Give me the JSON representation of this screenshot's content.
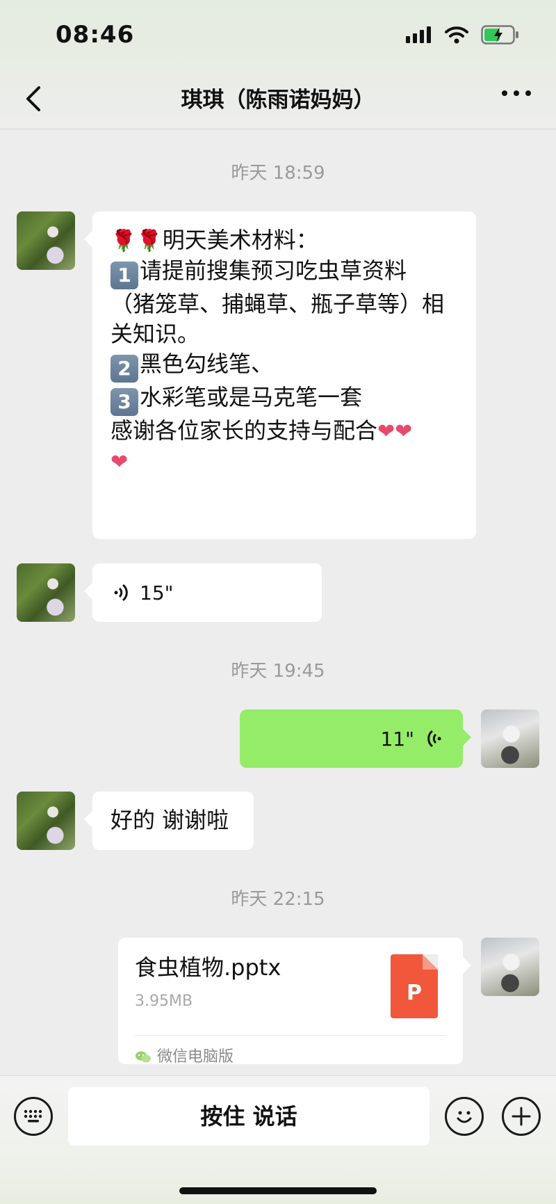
{
  "status": {
    "time": "08:46"
  },
  "nav": {
    "title": "琪琪（陈雨诺妈妈）"
  },
  "timestamps": [
    "昨天 18:59",
    "昨天 19:45",
    "昨天 22:15"
  ],
  "messages": {
    "m1": {
      "lines": [
        "明天美术材料：",
        "",
        "请提前搜集预习吃虫草资料",
        "（猪笼草、捕蝇草、瓶子草等）相",
        "关知识。",
        "黑色勾线笔、",
        "水彩笔或是马克笔一套",
        "",
        "感谢各位家长的支持与配合"
      ],
      "keycaps": [
        "1",
        "2",
        "3"
      ],
      "emoji_heart": "❤"
    },
    "m2": {
      "voice_duration": "15\""
    },
    "m3": {
      "voice_duration": "11\""
    },
    "m4": {
      "text": "好的 谢谢啦"
    },
    "m5": {
      "file_name": "食虫植物.pptx",
      "file_size": "3.95MB",
      "file_type_letter": "P",
      "source": "微信电脑版"
    }
  },
  "input_bar": {
    "talk_label": "按住 说话"
  },
  "colors": {
    "self_bubble": "#95ec69",
    "file_ppt": "#f0573b"
  }
}
